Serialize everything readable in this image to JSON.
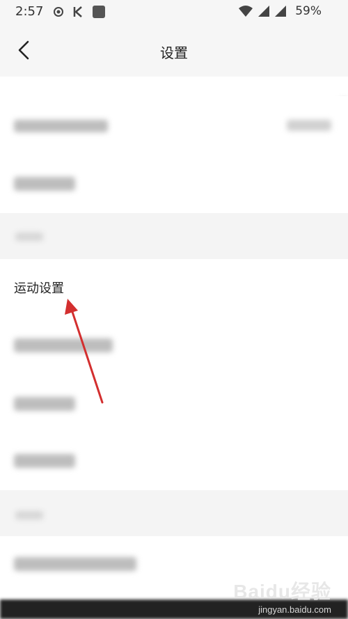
{
  "status_bar": {
    "time": "2:57",
    "battery": "59%"
  },
  "header": {
    "title": "设置"
  },
  "list": {
    "highlighted_item": "运动设置"
  },
  "watermark": {
    "logo": "Baidu经验",
    "url": "jingyan.baidu.com"
  },
  "colors": {
    "arrow": "#d32f2f",
    "background": "#f6f6f6",
    "row_background": "#ffffff"
  }
}
